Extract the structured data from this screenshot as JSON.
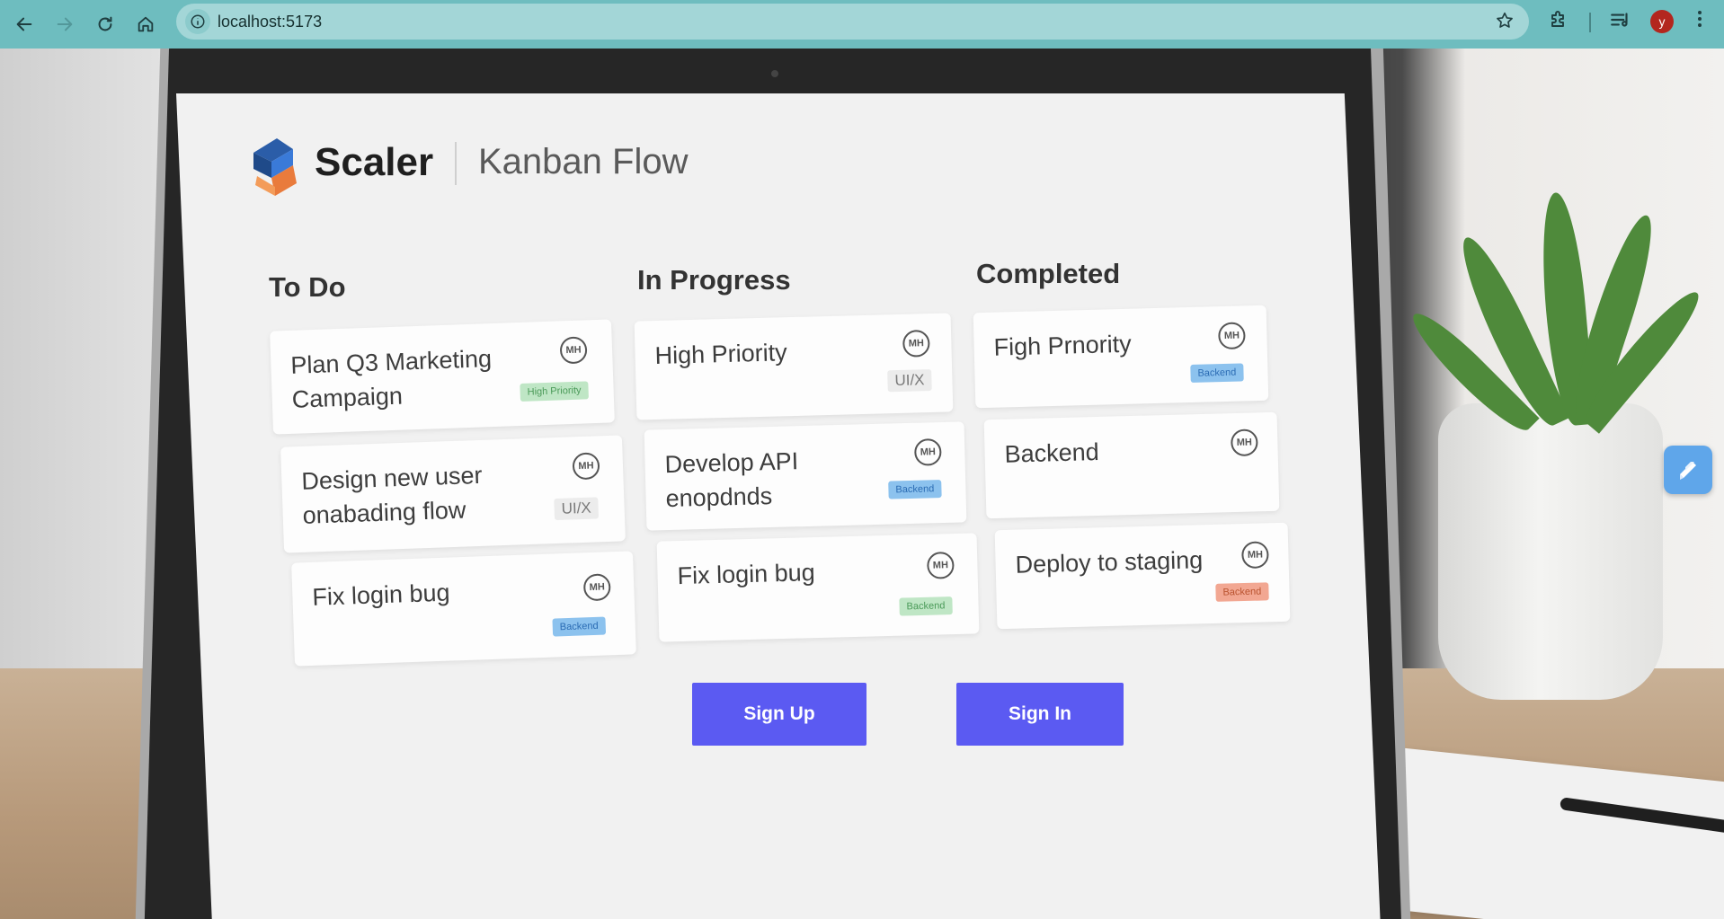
{
  "browser": {
    "url": "localhost:5173",
    "profile_initial": "y",
    "icons": [
      "back-icon",
      "forward-icon",
      "reload-icon",
      "home-icon",
      "info-icon",
      "star-icon",
      "extensions-icon",
      "media-icon",
      "menu-icon"
    ]
  },
  "app": {
    "brand": "Scaler",
    "product": "Kanban Flow",
    "accent_color": "#5b5af2"
  },
  "columns": [
    {
      "title": "To Do",
      "cards": [
        {
          "title_line1": "Plan Q3 Marketing",
          "title_line2": "Campaign",
          "icon_text": "MH",
          "tag": "High Priority",
          "tag_color": "green"
        },
        {
          "title_line1": "Design new user",
          "title_line2": "onabading flow",
          "icon_text": "MH",
          "tag": "UI/X",
          "tag_color": "grey"
        },
        {
          "title_line1": "Fix login bug",
          "title_line2": "",
          "icon_text": "MH",
          "tag": "Backend",
          "tag_color": "blue"
        }
      ]
    },
    {
      "title": "In Progress",
      "cards": [
        {
          "title_line1": "High Priority",
          "title_line2": "",
          "icon_text": "MH",
          "tag": "UI/X",
          "tag_color": "grey"
        },
        {
          "title_line1": "Develop API",
          "title_line2": "enopdnds",
          "icon_text": "MH",
          "tag": "Backend",
          "tag_color": "blue"
        },
        {
          "title_line1": "Fix login bug",
          "title_line2": "",
          "icon_text": "MH",
          "tag": "Backend",
          "tag_color": "green"
        }
      ]
    },
    {
      "title": "Completed",
      "cards": [
        {
          "title_line1": "Figh Prnority",
          "title_line2": "",
          "icon_text": "MH",
          "tag": "Backend",
          "tag_color": "blue"
        },
        {
          "title_line1": "Backend",
          "title_line2": "",
          "icon_text": "MH",
          "tag": "",
          "tag_color": ""
        },
        {
          "title_line1": "Deploy to staging",
          "title_line2": "",
          "icon_text": "MH",
          "tag": "Backend",
          "tag_color": "orange"
        }
      ]
    }
  ],
  "actions": {
    "sign_up": "Sign Up",
    "sign_in": "Sign In"
  }
}
